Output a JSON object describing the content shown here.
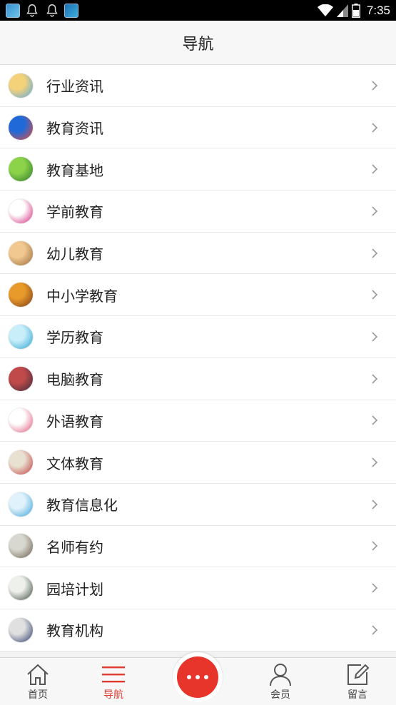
{
  "status_bar": {
    "time": "7:35",
    "left_icons": [
      "app-icon",
      "bell-icon",
      "bell-icon",
      "app-icon"
    ],
    "right_icons": [
      "wifi-icon",
      "signal-icon",
      "battery-icon"
    ]
  },
  "header": {
    "title": "导航"
  },
  "list": {
    "items": [
      {
        "label": "行业资讯",
        "icon": "industry-news-icon",
        "colors": [
          "#f4d27a",
          "#5aa8e0"
        ]
      },
      {
        "label": "教育资讯",
        "icon": "education-news-icon",
        "colors": [
          "#1f6ad8",
          "#e84b3c"
        ]
      },
      {
        "label": "教育基地",
        "icon": "education-base-icon",
        "colors": [
          "#8dd34a",
          "#2b7a2b"
        ]
      },
      {
        "label": "学前教育",
        "icon": "preschool-icon",
        "colors": [
          "#ffffff",
          "#d0237a"
        ]
      },
      {
        "label": "幼儿教育",
        "icon": "child-education-icon",
        "colors": [
          "#f0c890",
          "#9a6a3a"
        ]
      },
      {
        "label": "中小学教育",
        "icon": "school-education-icon",
        "colors": [
          "#e89a2a",
          "#7a3a1a"
        ]
      },
      {
        "label": "学历教育",
        "icon": "degree-education-icon",
        "colors": [
          "#c8eefa",
          "#2aa3d0"
        ]
      },
      {
        "label": "电脑教育",
        "icon": "computer-education-icon",
        "colors": [
          "#c04a4a",
          "#3a2a3a"
        ]
      },
      {
        "label": "外语教育",
        "icon": "language-education-icon",
        "colors": [
          "#ffffff",
          "#e0557a"
        ]
      },
      {
        "label": "文体教育",
        "icon": "sports-culture-icon",
        "colors": [
          "#e8e0d0",
          "#c03a3a"
        ]
      },
      {
        "label": "教育信息化",
        "icon": "education-it-icon",
        "colors": [
          "#e0f2fb",
          "#3aa0d8"
        ]
      },
      {
        "label": "名师有约",
        "icon": "famous-teacher-icon",
        "colors": [
          "#d8d8d0",
          "#6a5a4a"
        ]
      },
      {
        "label": "园培计划",
        "icon": "training-plan-icon",
        "colors": [
          "#eef0ec",
          "#3a4a3a"
        ]
      },
      {
        "label": "教育机构",
        "icon": "education-institution-icon",
        "colors": [
          "#e0e0e0",
          "#2a3a6a"
        ]
      }
    ]
  },
  "tabbar": {
    "tabs": [
      {
        "label": "首页",
        "icon": "home-icon"
      },
      {
        "label": "导航",
        "icon": "menu-icon",
        "active": true
      },
      {
        "label": "",
        "icon": "more-icon"
      },
      {
        "label": "会员",
        "icon": "user-icon"
      },
      {
        "label": "留言",
        "icon": "edit-icon"
      }
    ],
    "active_color": "#e03a2e",
    "center_button_color": "#e8352b"
  }
}
